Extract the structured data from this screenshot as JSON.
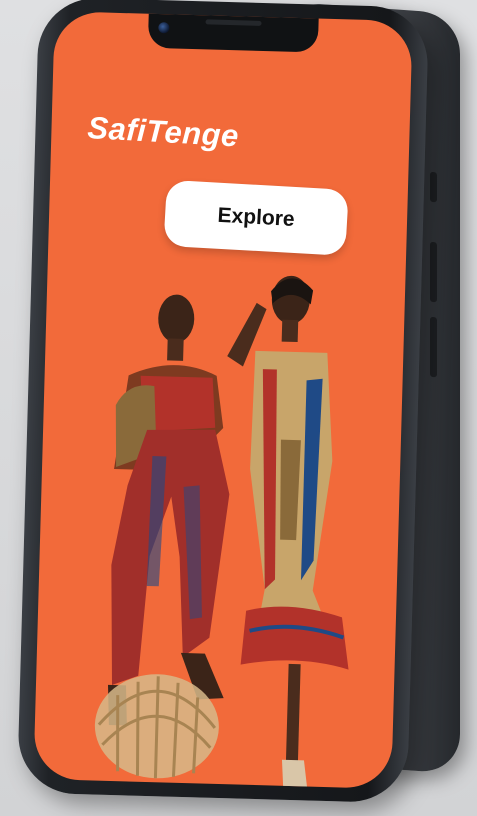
{
  "app": {
    "brand_name": "SafiTenge"
  },
  "hero": {
    "cta_label": "Explore",
    "image_description_icon": "fashion-models-photo"
  },
  "colors": {
    "screen_background": "#f26a3a",
    "button_background": "#ffffff",
    "brand_text": "#ffffff",
    "button_text": "#111111"
  }
}
